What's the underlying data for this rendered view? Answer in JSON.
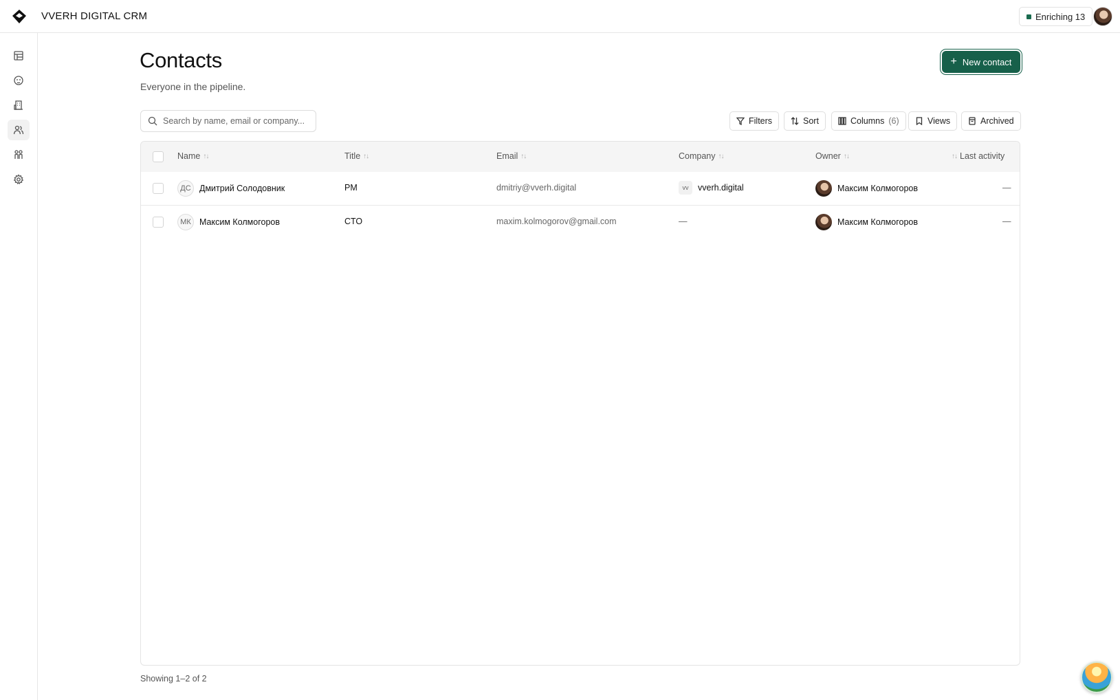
{
  "app": {
    "title": "VVERH DIGITAL CRM",
    "enriching_label": "Enriching 13"
  },
  "sidebar": {
    "items": [
      {
        "name": "dashboard",
        "icon": "layout-icon"
      },
      {
        "name": "chat",
        "icon": "face-icon"
      },
      {
        "name": "companies",
        "icon": "building-icon"
      },
      {
        "name": "contacts",
        "icon": "users-icon",
        "active": true
      },
      {
        "name": "team",
        "icon": "people-icon"
      },
      {
        "name": "settings",
        "icon": "gear-icon"
      }
    ]
  },
  "page": {
    "title": "Contacts",
    "subtitle": "Everyone in the pipeline.",
    "new_button": "New contact"
  },
  "search": {
    "placeholder": "Search by name, email or company..."
  },
  "toolbar": {
    "filters": "Filters",
    "sort": "Sort",
    "columns": "Columns",
    "columns_count": "(6)",
    "views": "Views",
    "archived": "Archived"
  },
  "table": {
    "headers": {
      "name": "Name",
      "title": "Title",
      "email": "Email",
      "company": "Company",
      "owner": "Owner",
      "last_activity": "Last activity"
    },
    "rows": [
      {
        "initials": "ДС",
        "name": "Дмитрий Солодовник",
        "title": "PM",
        "email": "dmitriy@vverh.digital",
        "company_logo": "vv",
        "company": "vverh.digital",
        "owner": "Максим Колмогоров",
        "last_activity": "—"
      },
      {
        "initials": "МК",
        "name": "Максим Колмогоров",
        "title": "CTO",
        "email": "maxim.kolmogorov@gmail.com",
        "company_logo": "",
        "company": "—",
        "owner": "Максим Колмогоров",
        "last_activity": "—"
      }
    ]
  },
  "footer": {
    "showing": "Showing 1–2 of 2"
  },
  "colors": {
    "accent": "#17604a",
    "border": "#e4e4e4",
    "header_bg": "#f5f5f5"
  }
}
